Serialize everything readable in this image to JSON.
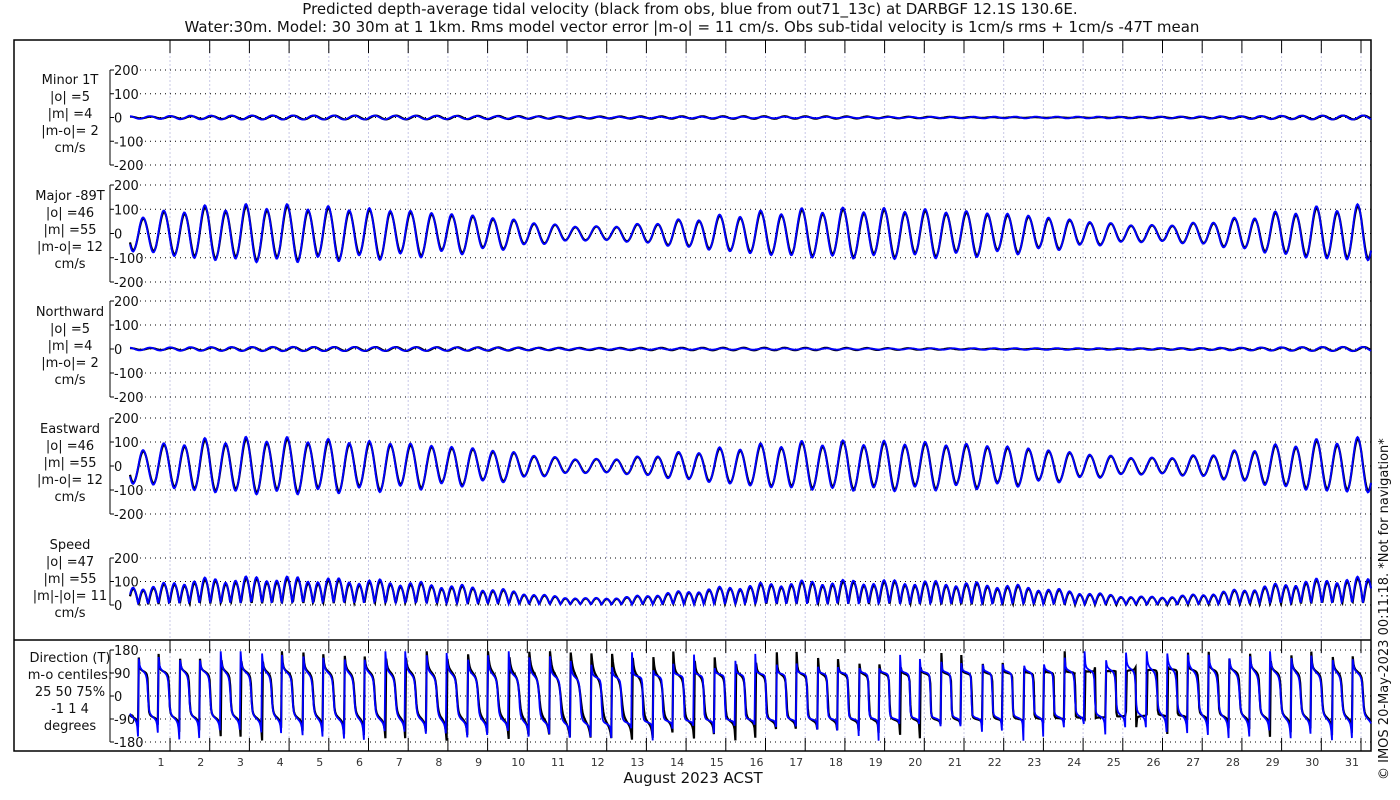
{
  "chart_data": {
    "type": "line",
    "title": [
      "Predicted depth-average tidal velocity (black from obs, blue from out71_13c) at DARBGF 12.1S 130.6E.",
      "Water:30m. Model: 30 30m at 1 1km. Rms model vector error |m-o| = 11 cm/s. Obs sub-tidal velocity is 1cm/s rms + 1cm/s -47T mean"
    ],
    "xlabel": "August 2023 ACST",
    "x_ticks": [
      "1",
      "2",
      "3",
      "4",
      "5",
      "6",
      "7",
      "8",
      "9",
      "10",
      "11",
      "12",
      "13",
      "14",
      "15",
      "16",
      "17",
      "18",
      "19",
      "20",
      "21",
      "22",
      "23",
      "24",
      "25",
      "26",
      "27",
      "28",
      "29",
      "30",
      "31"
    ],
    "xlim_days": [
      0,
      31.2
    ],
    "series_legend": {
      "obs": "black",
      "model": "blue"
    },
    "colors": {
      "obs": "#000000",
      "model": "#0000ff",
      "grid": "#000000",
      "day_grid": "#c8c8e6"
    },
    "semidiurnal_period_days": 0.5175,
    "major_daily_amplitude_cm_s": [
      70,
      95,
      100,
      105,
      100,
      95,
      90,
      80,
      70,
      55,
      35,
      25,
      30,
      45,
      60,
      75,
      85,
      90,
      90,
      90,
      85,
      80,
      70,
      55,
      40,
      30,
      35,
      50,
      70,
      90,
      100
    ],
    "panels": [
      {
        "id": "minor",
        "label": [
          "Minor 1T",
          "|o| =5",
          "|m| =4",
          "|m-o|= 2",
          "cm/s"
        ],
        "yticks": [
          "200",
          "100",
          "0",
          "-100",
          "-200"
        ],
        "ylim": [
          -200,
          200
        ]
      },
      {
        "id": "major",
        "label": [
          "Major -89T",
          "|o| =46",
          "|m| =55",
          "|m-o|= 12",
          "cm/s"
        ],
        "yticks": [
          "200",
          "100",
          "0",
          "-100",
          "-200"
        ],
        "ylim": [
          -200,
          200
        ]
      },
      {
        "id": "north",
        "label": [
          "Northward",
          "|o| =5",
          "|m| =4",
          "|m-o|= 2",
          "cm/s"
        ],
        "yticks": [
          "200",
          "100",
          "0",
          "-100",
          "-200"
        ],
        "ylim": [
          -200,
          200
        ]
      },
      {
        "id": "east",
        "label": [
          "Eastward",
          "|o| =46",
          "|m| =55",
          "|m-o|= 12",
          "cm/s"
        ],
        "yticks": [
          "200",
          "100",
          "0",
          "-100",
          "-200"
        ],
        "ylim": [
          -200,
          200
        ]
      },
      {
        "id": "speed",
        "label": [
          "Speed",
          "|o| =47",
          "|m| =55",
          "|m|-|o|= 11",
          "cm/s"
        ],
        "yticks": [
          "200",
          "100",
          "0"
        ],
        "ylim": [
          0,
          200
        ]
      },
      {
        "id": "direction",
        "label": [
          "Direction (T)",
          "m-o centiles:",
          "25  50  75%",
          "-1  1  4",
          "degrees"
        ],
        "yticks": [
          "180",
          "90",
          "0",
          "-90",
          "-180"
        ],
        "ylim": [
          -180,
          180
        ]
      }
    ],
    "copyright": "© IMOS 20-May-2023 00:11:18.  *Not for navigation*"
  }
}
